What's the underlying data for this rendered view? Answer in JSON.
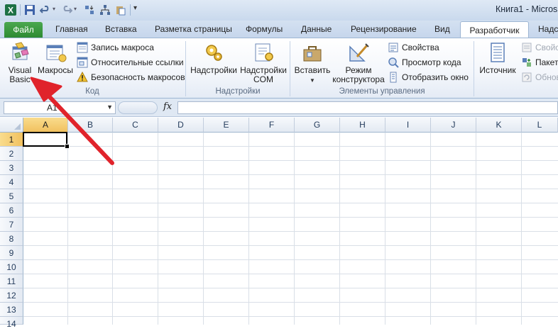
{
  "titlebar": {
    "title": "Книга1 - Micros",
    "qat_icons": [
      "excel-logo-icon",
      "save-icon",
      "undo-icon",
      "redo-icon",
      "sort-icon",
      "tree-icon",
      "paste-icon",
      "qat-customize-icon"
    ]
  },
  "tabs": {
    "file": "Файл",
    "home": "Главная",
    "insert": "Вставка",
    "layout": "Разметка страницы",
    "formulas": "Формулы",
    "data": "Данные",
    "review": "Рецензирование",
    "view": "Вид",
    "developer": "Разработчик",
    "addins": "Надст"
  },
  "ribbon": {
    "code": {
      "visual_basic_1": "Visual",
      "visual_basic_2": "Basic",
      "macros": "Макросы",
      "record_macro": "Запись макроса",
      "relative_refs": "Относительные ссылки",
      "macro_security": "Безопасность макросов",
      "label": "Код"
    },
    "addins": {
      "addins": "Надстройки",
      "com_1": "Надстройки",
      "com_2": "COM",
      "label": "Надстройки"
    },
    "controls": {
      "insert": "Вставить",
      "design_1": "Режим",
      "design_2": "конструктора",
      "properties": "Свойства",
      "view_code": "Просмотр кода",
      "run_dialog": "Отобразить окно",
      "label": "Элементы управления"
    },
    "xml": {
      "source": "Источник",
      "props": "Свойс",
      "packs": "Пакеты",
      "refresh": "Обнов"
    }
  },
  "formula_bar": {
    "name_box": "A1",
    "fx": "fx",
    "value": ""
  },
  "grid": {
    "columns": [
      "A",
      "B",
      "C",
      "D",
      "E",
      "F",
      "G",
      "H",
      "I",
      "J",
      "K",
      "L"
    ],
    "rows": [
      "1",
      "2",
      "3",
      "4",
      "5",
      "6",
      "7",
      "8",
      "9",
      "10",
      "11",
      "12",
      "13",
      "14"
    ],
    "selected": "A1"
  },
  "colors": {
    "file_tab": "#2d8a32",
    "annotation_arrow": "#e0232b",
    "selection_header": "#f1c15f"
  }
}
